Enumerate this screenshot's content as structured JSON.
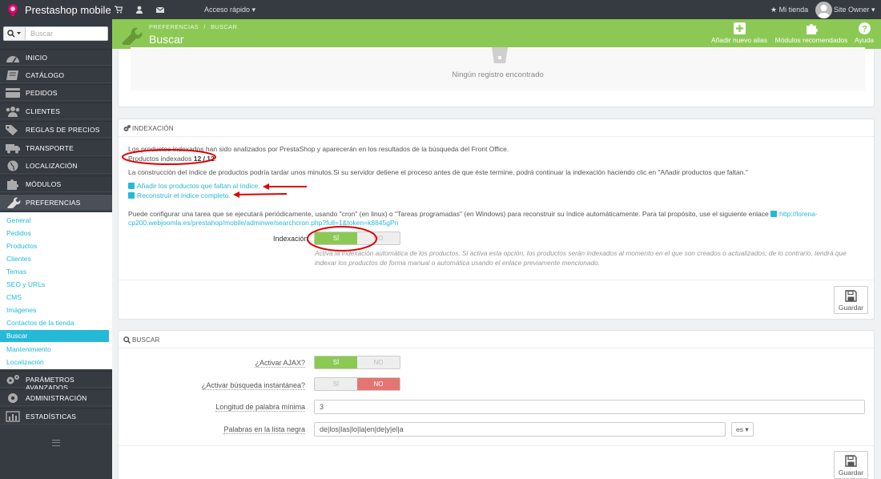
{
  "topbar": {
    "brand": "Prestashop mobile",
    "quick_access": "Acceso rápido ▾",
    "shop_link": "Mi tienda",
    "owner": "Site Owner ▾"
  },
  "sidebar": {
    "search_placeholder": "Buscar",
    "items": [
      {
        "label": "INICIO",
        "icon": "tachometer-icon"
      },
      {
        "label": "CATÁLOGO",
        "icon": "book-icon"
      },
      {
        "label": "PEDIDOS",
        "icon": "credit-card-icon"
      },
      {
        "label": "CLIENTES",
        "icon": "users-icon"
      },
      {
        "label": "REGLAS DE PRECIOS",
        "icon": "tags-icon"
      },
      {
        "label": "TRANSPORTE",
        "icon": "truck-icon"
      },
      {
        "label": "LOCALIZACIÓN",
        "icon": "globe-icon"
      },
      {
        "label": "MÓDULOS",
        "icon": "puzzle-icon"
      },
      {
        "label": "PREFERENCIAS",
        "icon": "wrench-icon"
      }
    ],
    "submenu": [
      "General",
      "Pedidos",
      "Productos",
      "Clientes",
      "Temas",
      "SEO y URLs",
      "CMS",
      "Imágenes",
      "Contactos de la tienda",
      "Buscar",
      "Mantenimiento",
      "Localización"
    ],
    "bottom_items": [
      {
        "label": "PARÁMETROS AVANZADOS",
        "icon": "cogs-icon"
      },
      {
        "label": "ADMINISTRACIÓN",
        "icon": "cog-icon"
      },
      {
        "label": "ESTADÍSTICAS",
        "icon": "bar-chart-icon"
      }
    ]
  },
  "header": {
    "breadcrumb_1": "PREFERENCIAS",
    "breadcrumb_sep": "/",
    "breadcrumb_2": "BUSCAR",
    "title": "Buscar",
    "add_alias": "Añadir nuevo alias",
    "recommended_modules": "Módulos recomendados",
    "help": "Ayuda"
  },
  "alias_panel": {
    "empty_text": "Ningún registro encontrado"
  },
  "indexing": {
    "title": "INDEXACIÓN",
    "line1": "Los productos indexados han sido analizados por PrestaShop y aparecerán en los resultados de la búsqueda del Front Office.",
    "indexed_label": "Productos indexados ",
    "indexed_count": "12 / 12",
    "indexed_suffix": ".",
    "line3": "La construcción del índice de productos podría tardar unos minutos.Si su servidor detiene el proceso antes de que éste termine, podrá continuar la indexación haciendo clic en \"Añadir productos que faltan.\"",
    "link_add_missing": "Añadir los productos que faltan al índice.",
    "link_rebuild": "Reconstruir el índice completo.",
    "cron_text": "Puede configurar una tarea que se ejecutará periódicamente, usando \"cron\" (en linux) o \"Tareas programadas\" (en Windows) para reconstruir su índice automáticamente. Para tal propósito, use el siguiente enlace",
    "cron_link_a": "http://lorena-",
    "cron_link_b": "cp200.webjoomla.es/prestahop/mobile/adminwe/searchcron.php?full=1&token=k8845gPn",
    "indexation_label": "Indexación",
    "switch_on": "SÍ",
    "switch_off": "NO",
    "help_line1": "Activa la indexación automática de los productos. Si activa esta opción, los productos serán indexados al momento en el que son creados o actualizados; de lo contrario, tendrá que",
    "help_line2": "indexar los productos de forma manual o automática usando el enlace previamente mencionado.",
    "save": "Guardar"
  },
  "search_panel": {
    "title": "BUSCAR",
    "ajax_label": "¿Activar AJAX?",
    "ajax_on": "SÍ",
    "ajax_off": "NO",
    "instant_label": "¿Activar búsqueda instantánea?",
    "instant_on": "SÍ",
    "instant_off": "NO",
    "min_word_label": "Longitud de palabra mínima",
    "min_word_value": "3",
    "blacklist_label": "Palabras en la lista negra",
    "blacklist_value": "de|los|las|lo|la|en|de|y|el|a",
    "lang": "es ▾",
    "save": "Guardar"
  },
  "colors": {
    "header_green": "#8bc954",
    "sidebar_dark": "#363a41",
    "link_blue": "#25b9d7",
    "annotation_red": "#e00000",
    "switch_red": "#e47573"
  }
}
